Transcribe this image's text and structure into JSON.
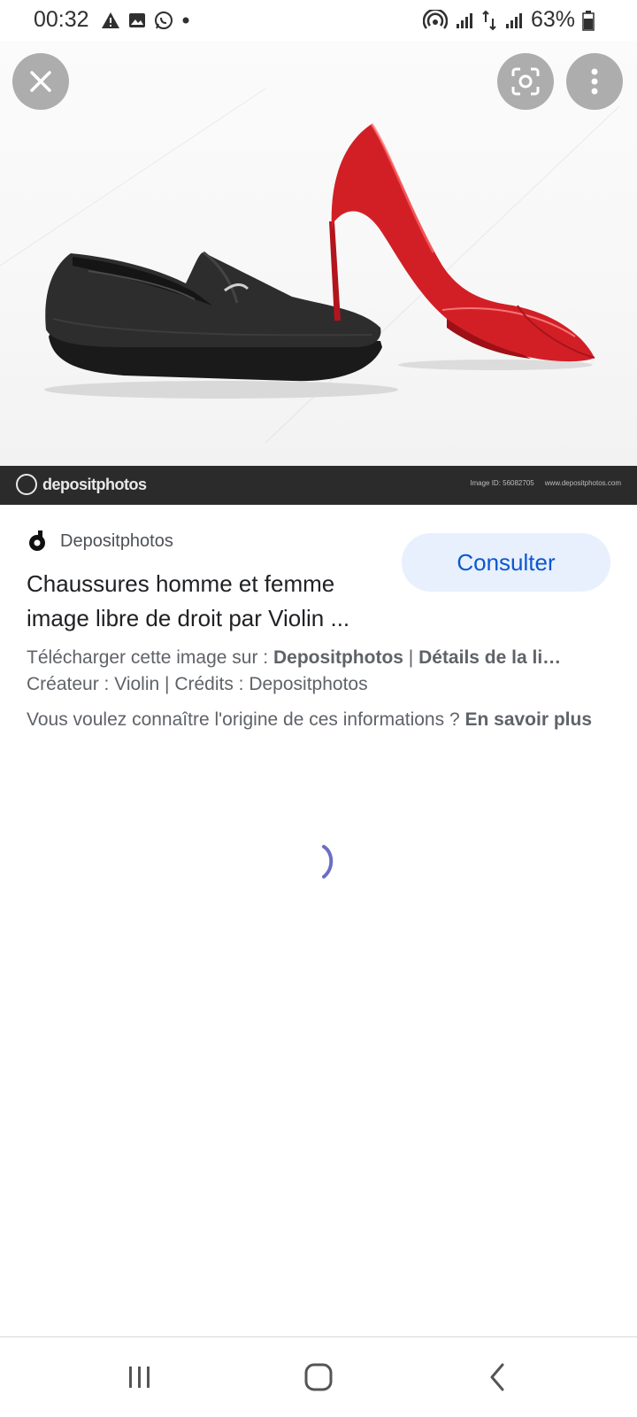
{
  "status_bar": {
    "time": "00:32",
    "battery": "63%",
    "icons": [
      "warning-icon",
      "image-icon",
      "whatsapp-icon",
      "dot-icon",
      "hotspot-icon",
      "signal-icon",
      "data-icon",
      "signal-icon",
      "battery-icon"
    ]
  },
  "hero": {
    "watermark_logo": "depositphotos",
    "watermark_id": "Image ID: 56082705",
    "watermark_url": "www.depositphotos.com"
  },
  "result": {
    "source": "Depositphotos",
    "consult_label": "Consulter",
    "title_line1": "Chaussures homme et femme",
    "title_line2": "image libre de droit par Violin ...",
    "download_prefix": "Télécharger cette image sur : ",
    "download_site": "Depositphotos",
    "separator": " | ",
    "license_details": "Détails de la li…",
    "credits_line": "Créateur : Violin | Crédits : Depositphotos",
    "origin_question": "Vous voulez connaître l'origine de ces informations ? ",
    "learn_more": "En savoir plus"
  },
  "colors": {
    "accent": "#0b57d0",
    "button_bg": "#e8f0fe",
    "spinner": "#6a6fc4",
    "heel_red": "#d21f26"
  }
}
